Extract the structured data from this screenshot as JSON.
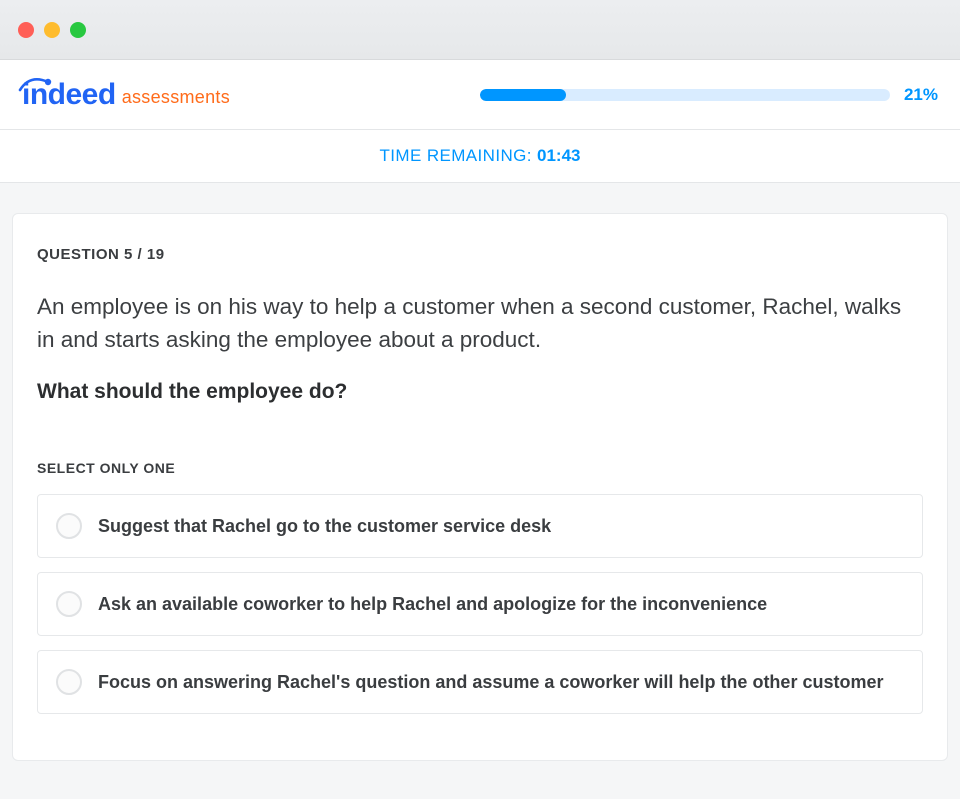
{
  "brand": {
    "name": "indeed",
    "suffix": "assessments"
  },
  "progress": {
    "percent_label": "21%",
    "percent_value": 21
  },
  "timer": {
    "label": "TIME REMAINING: ",
    "value": "01:43"
  },
  "question": {
    "counter": "QUESTION 5 / 19",
    "scenario": "An employee is on his way to help a customer when a second customer, Rachel, walks in and starts asking the employee about a product.",
    "prompt": "What should the employee do?",
    "select_instruction": "SELECT ONLY ONE",
    "options": [
      "Suggest that Rachel go to the customer service desk",
      "Ask an available coworker to help Rachel and apologize for the inconvenience",
      "Focus on answering Rachel's question and assume a coworker will help the other customer"
    ]
  }
}
